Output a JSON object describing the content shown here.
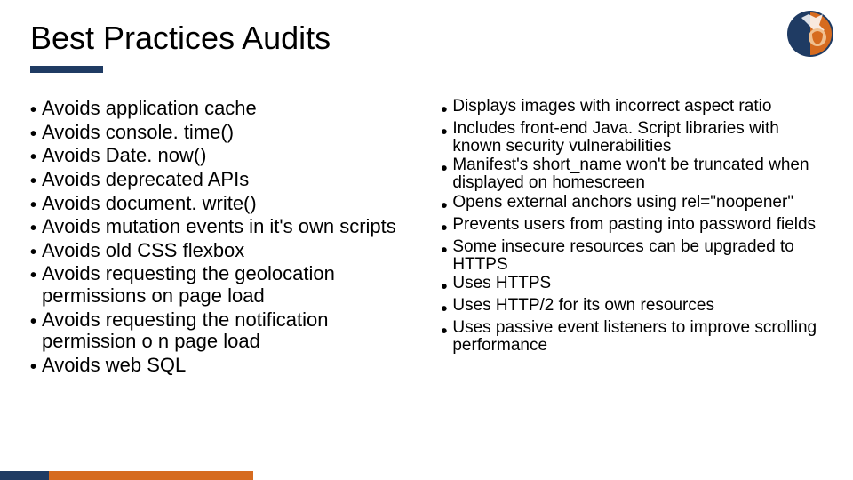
{
  "title": "Best Practices Audits",
  "left_items": [
    "Avoids application cache",
    "Avoids console. time()",
    "Avoids Date. now()",
    "Avoids deprecated APIs",
    "Avoids document. write()",
    "Avoids mutation events in it's own scripts",
    "Avoids old CSS flexbox",
    "Avoids requesting the geolocation permissions on page load",
    "Avoids requesting the notification permission o n page load",
    "Avoids web SQL"
  ],
  "right_items": [
    "Displays images with incorrect aspect ratio",
    "Includes front-end Java. Script libraries with known security vulnerabilities",
    "Manifest's short_name won't be truncated when displayed on homescreen",
    "Opens external anchors using rel=\"noopener\"",
    "Prevents users from pasting into password fields",
    "Some insecure resources can be upgraded to HTTPS",
    "Uses HTTPS",
    "Uses HTTP/2 for its own resources",
    "Uses passive event listeners to improve scrolling performance"
  ],
  "colors": {
    "navy": "#1f3b63",
    "orange": "#d66b1f"
  }
}
